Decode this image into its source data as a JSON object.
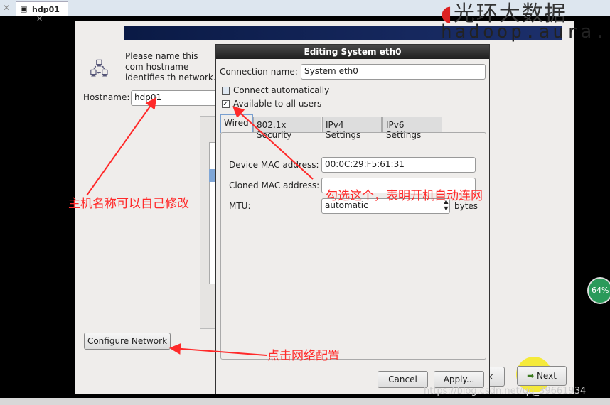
{
  "tab": {
    "title": "hdp01"
  },
  "watermark": {
    "line1": "光环大数据",
    "line2": "hadoop.aura.c"
  },
  "installer": {
    "intro": "Please name this com hostname identifies th network.",
    "hostname_label": "Hostname:",
    "hostname_value": "hdp01",
    "configure_network": "Configure Network",
    "back": "k",
    "next": "Next"
  },
  "dialog": {
    "title": "Editing System eth0",
    "connection_name_label": "Connection name:",
    "connection_name_value": "System eth0",
    "connect_automatically": "Connect automatically",
    "connect_automatically_checked": false,
    "available_all_users": "Available to all users",
    "available_all_users_checked": true,
    "tabs": [
      "Wired",
      "802.1x Security",
      "IPv4 Settings",
      "IPv6 Settings"
    ],
    "device_mac_label": "Device MAC address:",
    "device_mac_value": "00:0C:29:F5:61:31",
    "cloned_mac_label": "Cloned MAC address:",
    "cloned_mac_value": "",
    "mtu_label": "MTU:",
    "mtu_value": "automatic",
    "mtu_unit": "bytes",
    "cancel": "Cancel",
    "apply": "Apply..."
  },
  "annotations": {
    "hostname_note": "主机名称可以自己修改",
    "auto_connect_note": "勾选这个，表明开机自动连网",
    "configure_note": "点击网络配置"
  },
  "badge": {
    "percent": "64%"
  },
  "footer_watermark": "https://blog.csdn.net/qq_39661934",
  "colors": {
    "annotation": "#ff2a2a",
    "banner": "#0a1a45"
  }
}
